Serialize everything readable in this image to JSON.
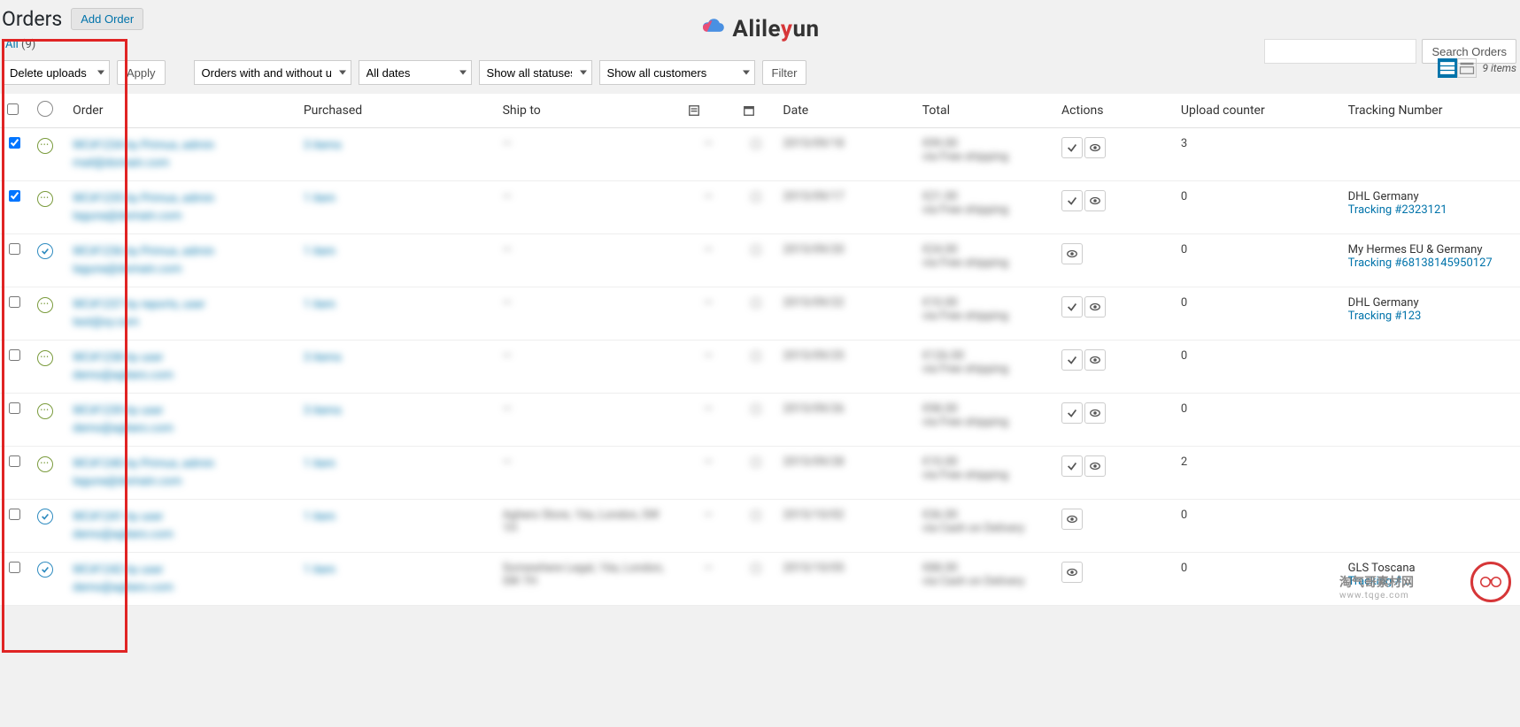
{
  "page": {
    "title": "Orders",
    "add_btn": "Add Order"
  },
  "logo": {
    "text_pre": "Alile",
    "text_red": "y",
    "text_post": "un"
  },
  "subsub": {
    "all_label": "All",
    "count": "(9)"
  },
  "search": {
    "button": "Search Orders",
    "placeholder": ""
  },
  "toolbar": {
    "bulk_action": "Delete uploads",
    "apply": "Apply",
    "uploads_filter": "Orders with and without u",
    "dates_filter": "All dates",
    "status_filter": "Show all statuses",
    "customer_filter": "Show all customers",
    "filter_btn": "Filter",
    "items_count": "9 items"
  },
  "columns": {
    "order": "Order",
    "purchased": "Purchased",
    "ship": "Ship to",
    "date": "Date",
    "total": "Total",
    "actions": "Actions",
    "upload": "Upload counter",
    "tracking": "Tracking Number"
  },
  "rows": [
    {
      "checked": true,
      "status": "processing",
      "order_l1": "WC#1234 by Primus, admin",
      "order_l2": "mail@domain.com",
      "purchased": "3 items",
      "ship": "—",
      "date": "2015/09/18",
      "total_1": "€99.00",
      "total_2": "via Free shipping",
      "actions": [
        "complete",
        "view"
      ],
      "upload": "3",
      "tracking_name": "",
      "tracking_link": ""
    },
    {
      "checked": true,
      "status": "processing",
      "order_l1": "WC#1235 by Primus, admin",
      "order_l2": "laguna@domain.com",
      "purchased": "1 item",
      "ship": "—",
      "date": "2015/09/17",
      "total_1": "€21.00",
      "total_2": "via Free shipping",
      "actions": [
        "complete",
        "view"
      ],
      "upload": "0",
      "tracking_name": "DHL Germany",
      "tracking_link": "Tracking #2323121"
    },
    {
      "checked": false,
      "status": "completed",
      "order_l1": "WC#1236 by Primus, admin",
      "order_l2": "laguna@domain.com",
      "purchased": "1 item",
      "ship": "—",
      "date": "2015/09/20",
      "total_1": "€24.00",
      "total_2": "via Free shipping",
      "actions": [
        "view"
      ],
      "upload": "0",
      "tracking_name": "My Hermes EU & Germany",
      "tracking_link": "Tracking #68138145950127"
    },
    {
      "checked": false,
      "status": "processing",
      "order_l1": "WC#1237 by reports, user",
      "order_l2": "test@xy.com",
      "purchased": "1 item",
      "ship": "—",
      "date": "2015/09/22",
      "total_1": "€10.00",
      "total_2": "via Free shipping",
      "actions": [
        "complete",
        "view"
      ],
      "upload": "0",
      "tracking_name": "DHL Germany",
      "tracking_link": "Tracking #123"
    },
    {
      "checked": false,
      "status": "processing",
      "order_l1": "WC#1238 by user",
      "order_l2": "demo@aghero.com",
      "purchased": "3 items",
      "ship": "—",
      "date": "2015/09/25",
      "total_1": "€126.00",
      "total_2": "via Free shipping",
      "actions": [
        "complete",
        "view"
      ],
      "upload": "0",
      "tracking_name": "",
      "tracking_link": ""
    },
    {
      "checked": false,
      "status": "processing",
      "order_l1": "WC#1239 by user",
      "order_l2": "demo@aghero.com",
      "purchased": "3 items",
      "ship": "—",
      "date": "2015/09/26",
      "total_1": "€98.00",
      "total_2": "via Free shipping",
      "actions": [
        "complete",
        "view"
      ],
      "upload": "0",
      "tracking_name": "",
      "tracking_link": ""
    },
    {
      "checked": false,
      "status": "processing",
      "order_l1": "WC#1240 by Primus, admin",
      "order_l2": "laguna@domain.com",
      "purchased": "1 item",
      "ship": "—",
      "date": "2015/09/28",
      "total_1": "€10.00",
      "total_2": "via Free shipping",
      "actions": [
        "complete",
        "view"
      ],
      "upload": "2",
      "tracking_name": "",
      "tracking_link": ""
    },
    {
      "checked": false,
      "status": "completed",
      "order_l1": "WC#1241 by user",
      "order_l2": "demo@aghero.com",
      "purchased": "1 item",
      "ship": "Aghero Store, 16a, London, SW 1H",
      "date": "2015/10/02",
      "total_1": "€36.00",
      "total_2": "via Cash on Delivery",
      "actions": [
        "view"
      ],
      "upload": "0",
      "tracking_name": "",
      "tracking_link": ""
    },
    {
      "checked": false,
      "status": "completed",
      "order_l1": "WC#1242 by user",
      "order_l2": "demo@aghero.com",
      "purchased": "1 item",
      "ship": "Somewhere Legal, 16a, London, SW 7H",
      "date": "2015/10/05",
      "total_1": "€88.00",
      "total_2": "via Cash on Delivery",
      "actions": [
        "view"
      ],
      "upload": "0",
      "tracking_name": "GLS Toscana",
      "tracking_link": "Tracking #..."
    }
  ],
  "watermark": {
    "main": "淘气哥素材网",
    "sub": "www.tqge.com"
  }
}
